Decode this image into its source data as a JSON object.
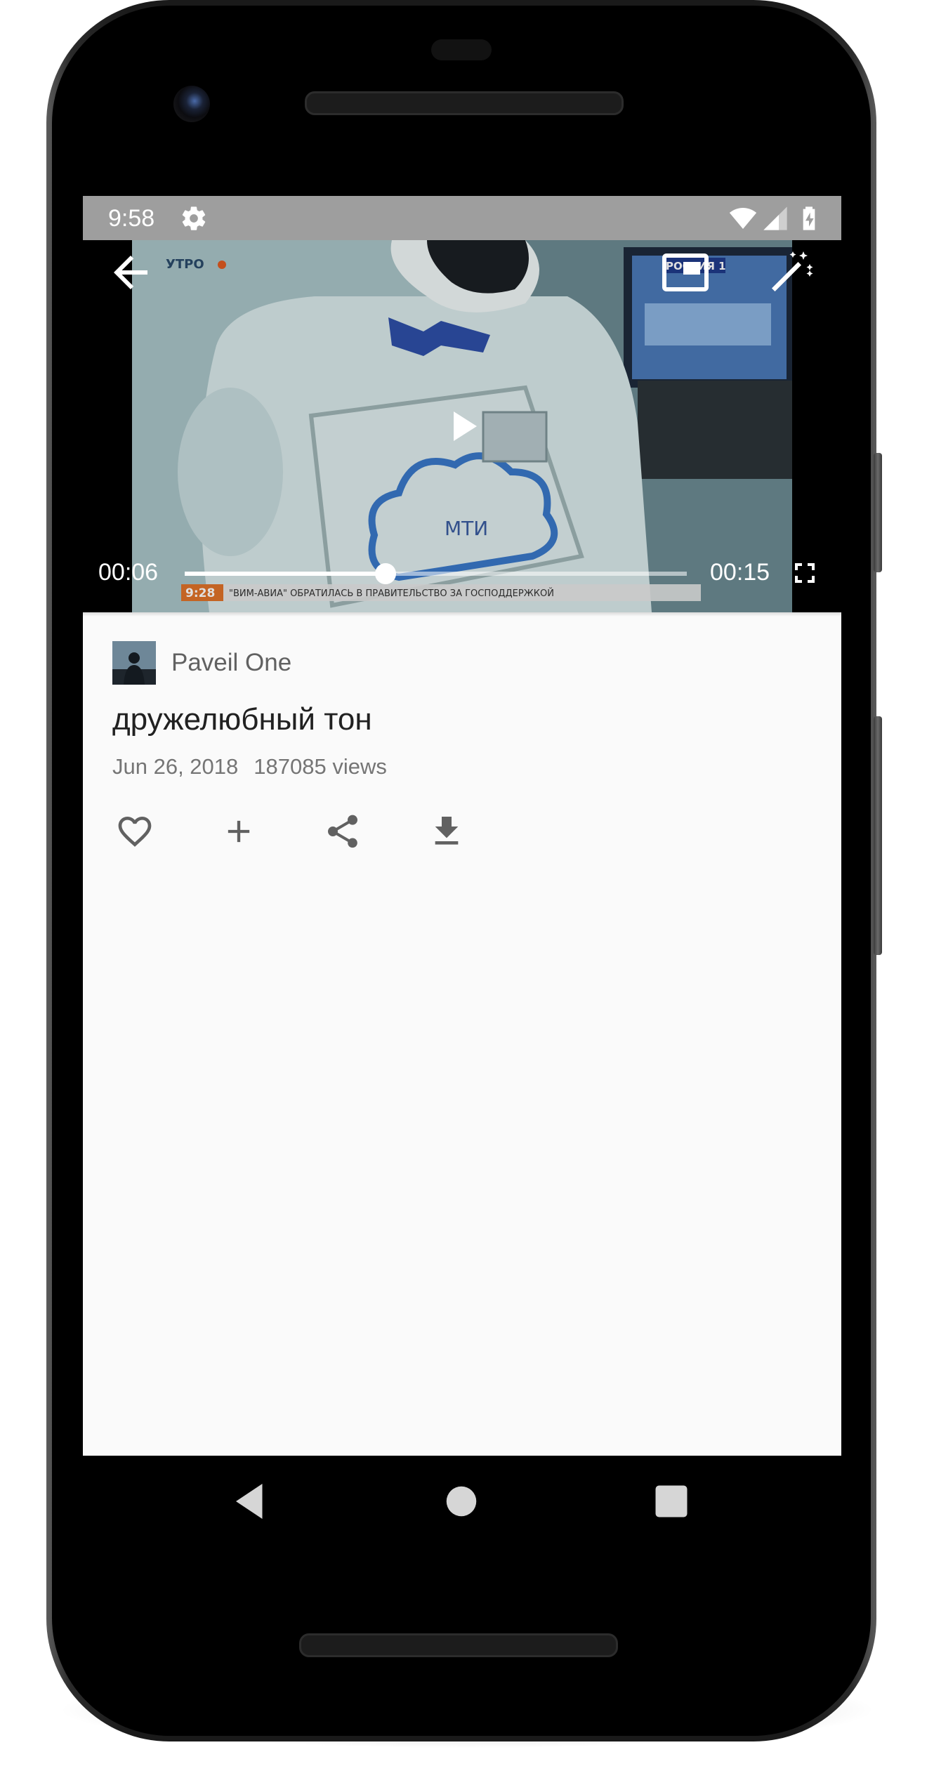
{
  "status_bar": {
    "time": "9:58",
    "icons": [
      "settings-icon",
      "wifi-icon",
      "cell-signal-icon",
      "battery-charging-icon"
    ]
  },
  "player": {
    "current_time": "00:06",
    "duration": "00:15",
    "progress_fraction": 0.4,
    "buttons": [
      "back-arrow-icon",
      "picture-in-picture-icon",
      "magic-wand-icon",
      "play-icon",
      "fullscreen-icon"
    ],
    "broadcast_overlay": {
      "channel_tag": "УТРО",
      "channel_logo": "РОССИЯ 1",
      "clock": "9:28",
      "ticker": "\"ВИМ-АВИА\" ОБРАТИЛАСЬ В ПРАВИТЕЛЬСТВО ЗА ГОСПОДДЕРЖКОЙ",
      "screen_text": "МТИ"
    }
  },
  "video": {
    "channel_name": "Paveil One",
    "title": "дружелюбный тон",
    "date": "Jun 26, 2018",
    "views": "187085 views"
  },
  "actions": [
    "heart-icon",
    "add-icon",
    "share-icon",
    "download-icon"
  ],
  "nav_bar": [
    "back-triangle-icon",
    "home-circle-icon",
    "recents-square-icon"
  ],
  "colors": {
    "status_bar": "#9e9e9e",
    "content_background": "#fafafa",
    "title_text": "#212121",
    "meta_text": "#757575"
  }
}
